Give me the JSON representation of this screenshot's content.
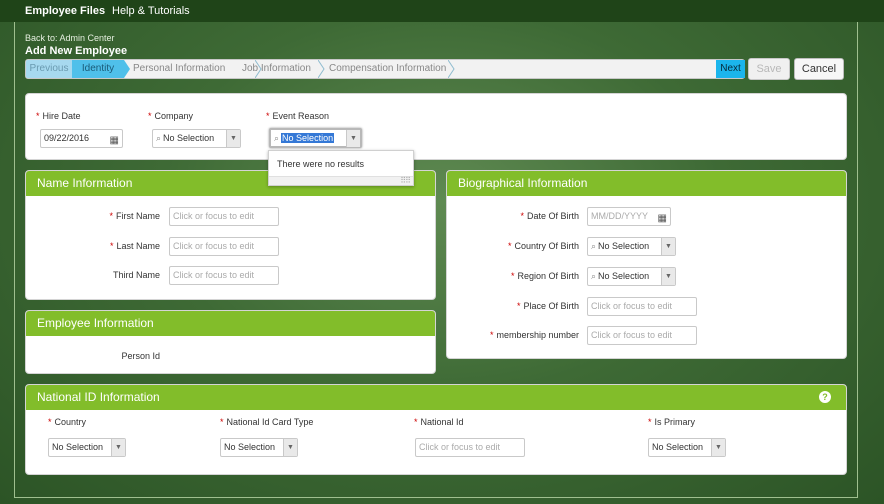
{
  "nav": {
    "employee_files": "Employee Files",
    "help": "Help & Tutorials"
  },
  "header": {
    "back_link": "Back to: Admin Center",
    "title": "Add New Employee"
  },
  "stepper": {
    "previous": "Previous",
    "steps": [
      "Identity",
      "Personal Information",
      "Job Information",
      "Compensation Information"
    ],
    "next": "Next"
  },
  "actions": {
    "save": "Save",
    "cancel": "Cancel"
  },
  "hire_section": {
    "hire_date_label": "Hire Date",
    "hire_date_value": "09/22/2016",
    "company_label": "Company",
    "company_value": "No Selection",
    "event_reason_label": "Event Reason",
    "event_reason_value": "No Selection",
    "dropdown_message": "There were no results"
  },
  "name_info": {
    "title": "Name Information",
    "first_name_label": "First Name",
    "last_name_label": "Last Name",
    "third_name_label": "Third Name",
    "placeholder": "Click or focus to edit"
  },
  "employee_info": {
    "title": "Employee Information",
    "person_id_label": "Person Id"
  },
  "bio_info": {
    "title": "Biographical Information",
    "dob_label": "Date Of Birth",
    "dob_placeholder": "MM/DD/YYYY",
    "country_of_birth_label": "Country Of Birth",
    "country_of_birth_value": "No Selection",
    "region_of_birth_label": "Region Of Birth",
    "region_of_birth_value": "No Selection",
    "place_of_birth_label": "Place Of Birth",
    "membership_label": "membership number",
    "placeholder": "Click or focus to edit"
  },
  "national_id": {
    "title": "National ID Information",
    "help": "?",
    "country_label": "Country",
    "country_value": "No Selection",
    "card_type_label": "National Id Card Type",
    "card_type_value": "No Selection",
    "national_id_label": "National Id",
    "national_id_placeholder": "Click or focus to edit",
    "is_primary_label": "Is Primary",
    "is_primary_value": "No Selection"
  },
  "icons": {
    "calendar": "calendar-icon",
    "search": "search-icon",
    "dropdown": "chevron-down-icon"
  },
  "colors": {
    "section_header": "#82bd2a",
    "step_active": "#4fc0ea",
    "next_button": "#1bb5ec",
    "required": "#cc0000"
  }
}
